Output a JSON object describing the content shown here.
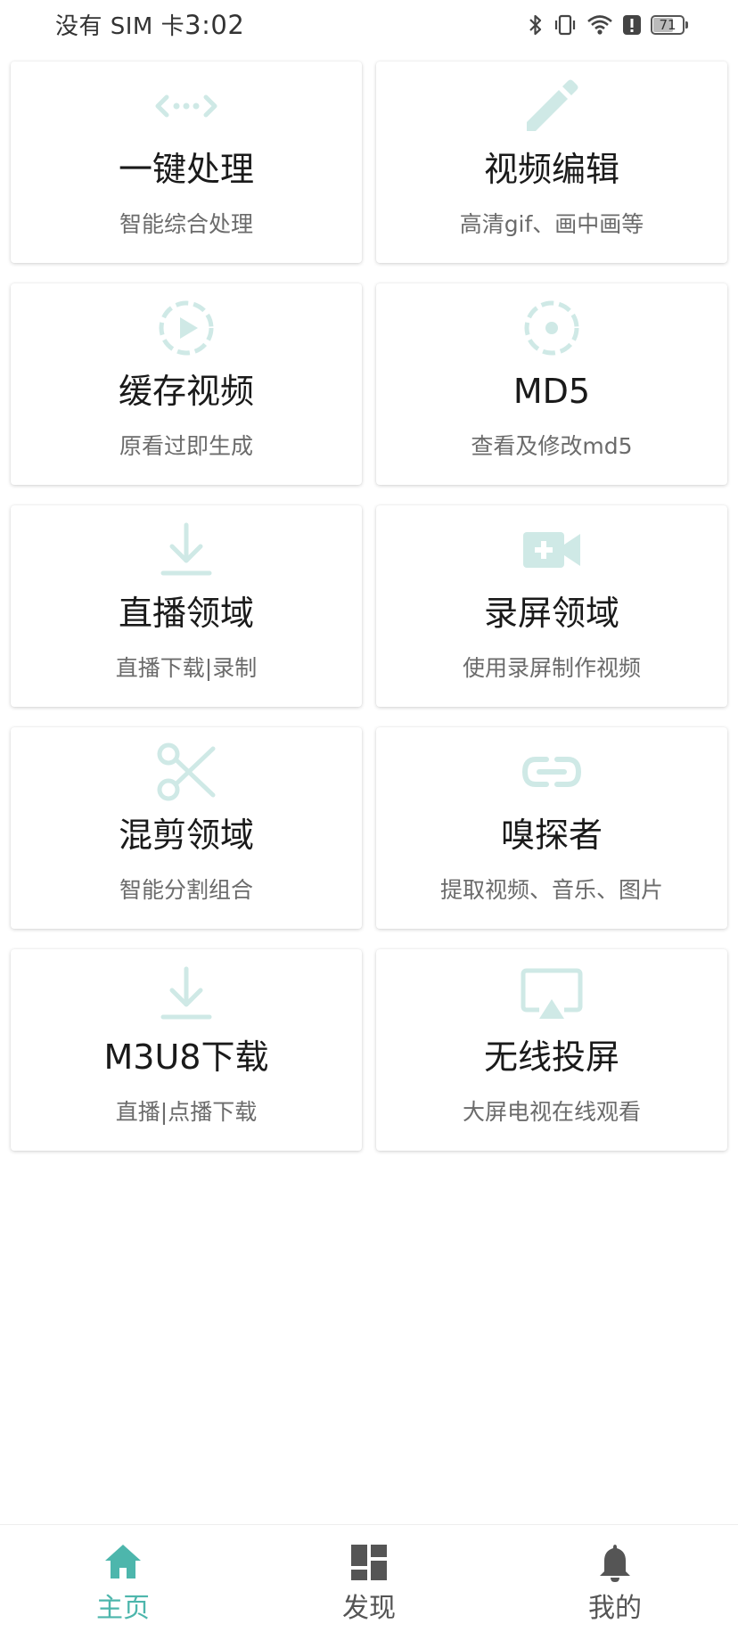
{
  "status_bar": {
    "carrier": "没有 SIM 卡",
    "time": "3:02",
    "battery": "71",
    "battery_level": 0.71,
    "icons": [
      "bluetooth-icon",
      "vibrate-icon",
      "wifi-icon",
      "alert-icon",
      "battery-icon"
    ]
  },
  "colors": {
    "accent": "#4db6ac",
    "icon_tint": "#cfe9e6",
    "nav_inactive": "#555555"
  },
  "cards": [
    {
      "title": "一键处理",
      "subtitle": "智能综合处理",
      "icon": "code-arrows-icon"
    },
    {
      "title": "视频编辑",
      "subtitle": "高清gif、画中画等",
      "icon": "pencil-icon"
    },
    {
      "title": "缓存视频",
      "subtitle": "原看过即生成",
      "icon": "play-circle-dashed-icon"
    },
    {
      "title": "MD5",
      "subtitle": "查看及修改md5",
      "icon": "dashed-circle-icon"
    },
    {
      "title": "直播领域",
      "subtitle": "直播下载|录制",
      "icon": "download-icon"
    },
    {
      "title": "录屏领域",
      "subtitle": "使用录屏制作视频",
      "icon": "video-add-icon"
    },
    {
      "title": "混剪领域",
      "subtitle": "智能分割组合",
      "icon": "scissors-icon"
    },
    {
      "title": "嗅探者",
      "subtitle": "提取视频、音乐、图片",
      "icon": "link-icon"
    },
    {
      "title": "M3U8下载",
      "subtitle": "直播|点播下载",
      "icon": "download-icon"
    },
    {
      "title": "无线投屏",
      "subtitle": "大屏电视在线观看",
      "icon": "cast-screen-icon"
    }
  ],
  "bottom_nav": {
    "items": [
      {
        "label": "主页",
        "icon": "home-icon",
        "active": true
      },
      {
        "label": "发现",
        "icon": "dashboard-icon",
        "active": false
      },
      {
        "label": "我的",
        "icon": "bell-icon",
        "active": false
      }
    ]
  }
}
